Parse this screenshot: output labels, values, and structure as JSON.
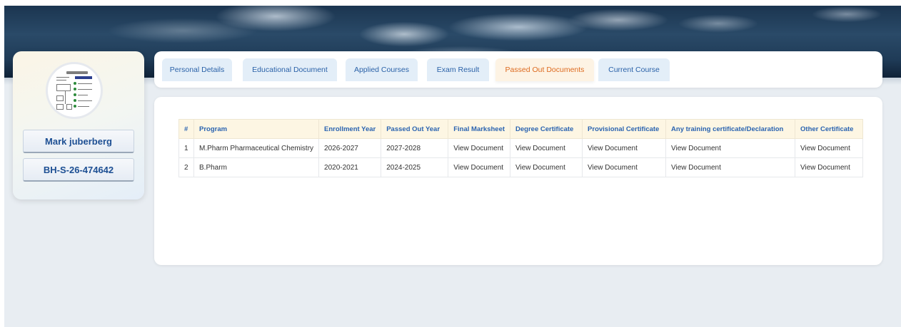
{
  "profile": {
    "name": "Mark juberberg",
    "id": "BH-S-26-474642"
  },
  "tabs": [
    {
      "label": "Personal Details",
      "active": false
    },
    {
      "label": "Educational Document",
      "active": false
    },
    {
      "label": "Applied Courses",
      "active": false
    },
    {
      "label": "Exam Result",
      "active": false
    },
    {
      "label": "Passed Out Documents",
      "active": true
    },
    {
      "label": "Current Course",
      "active": false
    }
  ],
  "table": {
    "headers": [
      "#",
      "Program",
      "Enrollment Year",
      "Passed Out Year",
      "Final Marksheet",
      "Degree Certificate",
      "Provisional Certificate",
      "Any training certificate/Declaration",
      "Other Certificate"
    ],
    "rows": [
      [
        "1",
        "M.Pharm Pharmaceutical Chemistry",
        "2026-2027",
        "2027-2028",
        "View Document",
        "View Document",
        "View Document",
        "View Document",
        "View Document"
      ],
      [
        "2",
        "B.Pharm",
        "2020-2021",
        "2024-2025",
        "View Document",
        "View Document",
        "View Document",
        "View Document",
        "View Document"
      ]
    ]
  },
  "colors": {
    "tab_text": "#2b62a8",
    "tab_active_text": "#dd6a1f",
    "name_text": "#1d4f93",
    "header_bg": "#fdf6e3"
  }
}
